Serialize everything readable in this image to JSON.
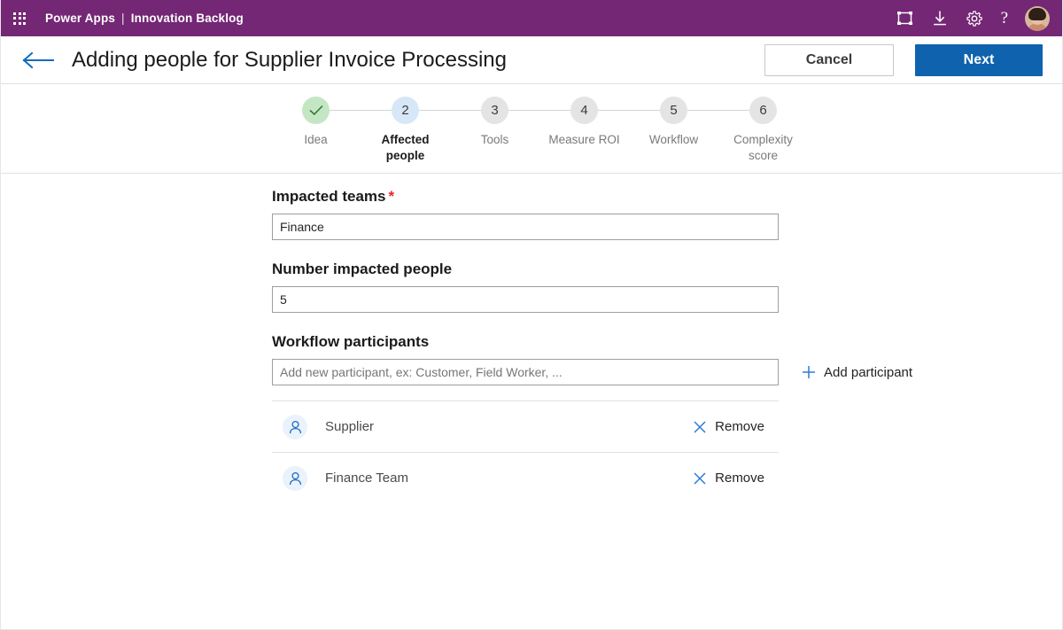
{
  "topbar": {
    "waffle_label": "app-launcher",
    "brand": "Power Apps",
    "divider": "|",
    "app_name": "Innovation Backlog",
    "icons": [
      "fit-screen-icon",
      "download-icon",
      "gear-icon",
      "help-icon"
    ],
    "help_glyph": "?"
  },
  "header": {
    "back_label": "back-arrow",
    "title": "Adding people for Supplier Invoice Processing",
    "cancel_label": "Cancel",
    "next_label": "Next"
  },
  "stepper": {
    "steps": [
      {
        "number": "1",
        "label": "Idea",
        "state": "done",
        "glyph": "check"
      },
      {
        "number": "2",
        "label": "Affected people",
        "state": "active"
      },
      {
        "number": "3",
        "label": "Tools",
        "state": "todo"
      },
      {
        "number": "4",
        "label": "Measure ROI",
        "state": "todo"
      },
      {
        "number": "5",
        "label": "Workflow",
        "state": "todo"
      },
      {
        "number": "6",
        "label": "Complexity score",
        "state": "todo"
      }
    ]
  },
  "form": {
    "impacted_teams": {
      "label": "Impacted teams",
      "required_mark": "*",
      "value": "Finance",
      "placeholder": ""
    },
    "number_impacted_people": {
      "label": "Number impacted people",
      "value": "5",
      "placeholder": ""
    },
    "workflow_participants": {
      "label": "Workflow participants",
      "input_value": "",
      "placeholder": "Add new participant, ex: Customer, Field Worker, ...",
      "add_label": "Add participant",
      "remove_label": "Remove",
      "items": [
        {
          "name": "Supplier"
        },
        {
          "name": "Finance Team"
        }
      ]
    }
  },
  "colors": {
    "brand_purple": "#742774",
    "primary_blue": "#0f62ad",
    "link_blue": "#2b7cd3",
    "required_red": "#e02b2b",
    "step_done_green": "#c5e6c5",
    "step_active_blue": "#d7e7f7",
    "step_todo_gray": "#e4e4e4"
  }
}
